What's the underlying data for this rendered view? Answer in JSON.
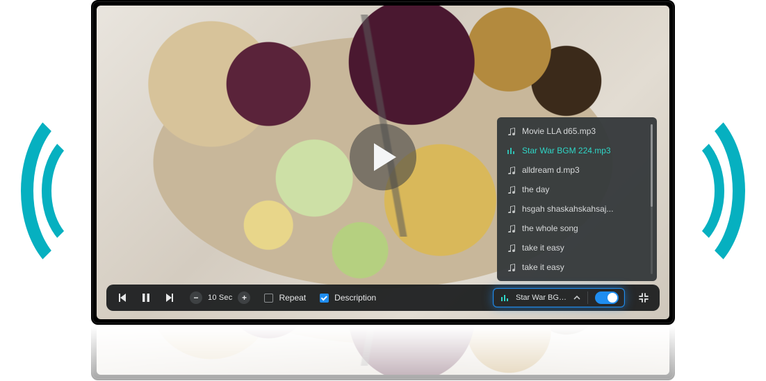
{
  "colors": {
    "accent_blue": "#1f8df0",
    "accent_teal": "#2fd6c7",
    "soundwave": "#06b0c0"
  },
  "player": {
    "play_icon": "play-icon",
    "seek_label": "10 Sec",
    "repeat_label": "Repeat",
    "repeat_checked": false,
    "description_label": "Description",
    "description_checked": true,
    "current_track": "Star War BGM 22...",
    "music_toggle_on": true
  },
  "playlist": {
    "active_index": 1,
    "items": [
      {
        "label": "Movie LLA d65.mp3"
      },
      {
        "label": "Star War BGM 224.mp3"
      },
      {
        "label": "alldream d.mp3"
      },
      {
        "label": "the day"
      },
      {
        "label": "hsgah shaskahskahsaj..."
      },
      {
        "label": "the whole song"
      },
      {
        "label": "take it easy"
      },
      {
        "label": "take it easy"
      }
    ]
  }
}
